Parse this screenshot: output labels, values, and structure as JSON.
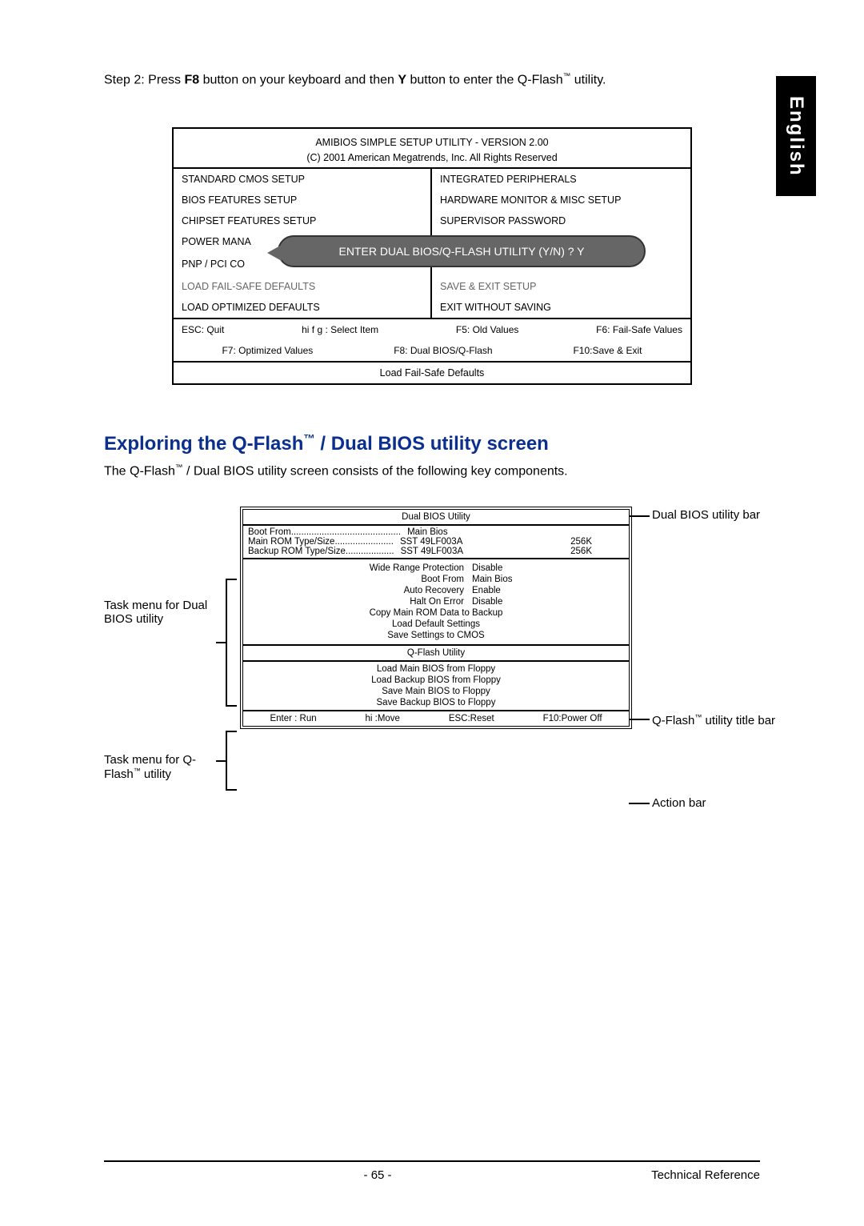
{
  "lang_tab": "English",
  "step2": {
    "prefix": "Step 2: Press ",
    "key1": "F8",
    "mid": " button on your keyboard and then ",
    "key2": "Y",
    "suffix": " button to enter the Q-Flash",
    "tm": "™",
    "end": " utility."
  },
  "bios": {
    "title1": "AMIBIOS SIMPLE SETUP UTILITY - VERSION 2.00",
    "title2": "(C) 2001 American Megatrends, Inc. All Rights Reserved",
    "rows": [
      [
        "STANDARD CMOS SETUP",
        "INTEGRATED PERIPHERALS"
      ],
      [
        "BIOS FEATURES SETUP",
        "HARDWARE MONITOR & MISC SETUP"
      ],
      [
        "CHIPSET FEATURES SETUP",
        "SUPERVISOR PASSWORD"
      ]
    ],
    "pm": "POWER MANA",
    "pnp": "PNP / PCI CO",
    "dialog": "ENTER DUAL BIOS/Q-FLASH UTILITY (Y/N) ? Y",
    "rows2": [
      [
        "LOAD FAIL-SAFE DEFAULTS",
        "SAVE & EXIT SETUP"
      ],
      [
        "LOAD OPTIMIZED DEFAULTS",
        "EXIT WITHOUT SAVING"
      ]
    ],
    "foot1": {
      "esc": "ESC: Quit",
      "arrows": "hi f g : Select Item",
      "f5": "F5: Old Values",
      "f6": "F6: Fail-Safe Values"
    },
    "foot2": {
      "f7": "F7: Optimized Values",
      "f8": "F8: Dual BIOS/Q-Flash",
      "f10": "F10:Save & Exit"
    },
    "failsafe": "Load Fail-Safe Defaults"
  },
  "heading": {
    "pre": "Exploring the Q-Flash",
    "tm": "™",
    "post": " / Dual BIOS utility screen"
  },
  "intro": {
    "pre": "The Q-Flash",
    "tm": "™",
    "post": " / Dual BIOS utility screen consists of the following key components."
  },
  "util": {
    "title": "Dual BIOS Utility",
    "info": [
      {
        "k": "Boot From",
        "dots": "...........................................",
        "v": "Main Bios",
        "r": ""
      },
      {
        "k": "Main ROM Type/Size",
        "dots": ".......................",
        "v": "SST 49LF003A",
        "r": "256K"
      },
      {
        "k": "Backup ROM Type/Size",
        "dots": "...................",
        "v": "SST 49LF003A",
        "r": "256K"
      }
    ],
    "opts": [
      {
        "lbl": "Wide Range Protection",
        "val": "Disable"
      },
      {
        "lbl": "Boot From",
        "val": "Main Bios"
      },
      {
        "lbl": "Auto Recovery",
        "val": "Enable"
      },
      {
        "lbl": "Halt On Error",
        "val": "Disable"
      }
    ],
    "opts_single": [
      "Copy Main ROM Data to Backup",
      "Load Default Settings",
      "Save Settings to CMOS"
    ],
    "qflash_title": "Q-Flash Utility",
    "qflash_items": [
      "Load Main BIOS from Floppy",
      "Load Backup BIOS from Floppy",
      "Save Main BIOS to Floppy",
      "Save Backup BIOS to Floppy"
    ],
    "action": {
      "enter": "Enter : Run",
      "move": "hi :Move",
      "esc": "ESC:Reset",
      "f10": "F10:Power Off"
    }
  },
  "annot": {
    "dual_bar": "Dual BIOS utility bar",
    "task_dual": "Task menu for Dual BIOS utility",
    "task_qflash_pre": "Task menu for Q-Flash",
    "task_qflash_tm": "™",
    "task_qflash_post": " utility",
    "qflash_bar_pre": "Q-Flash",
    "qflash_bar_tm": "™",
    "qflash_bar_post": " utility title bar",
    "action_bar": "Action bar"
  },
  "footer": {
    "page": "- 65 -",
    "ref": "Technical Reference"
  }
}
